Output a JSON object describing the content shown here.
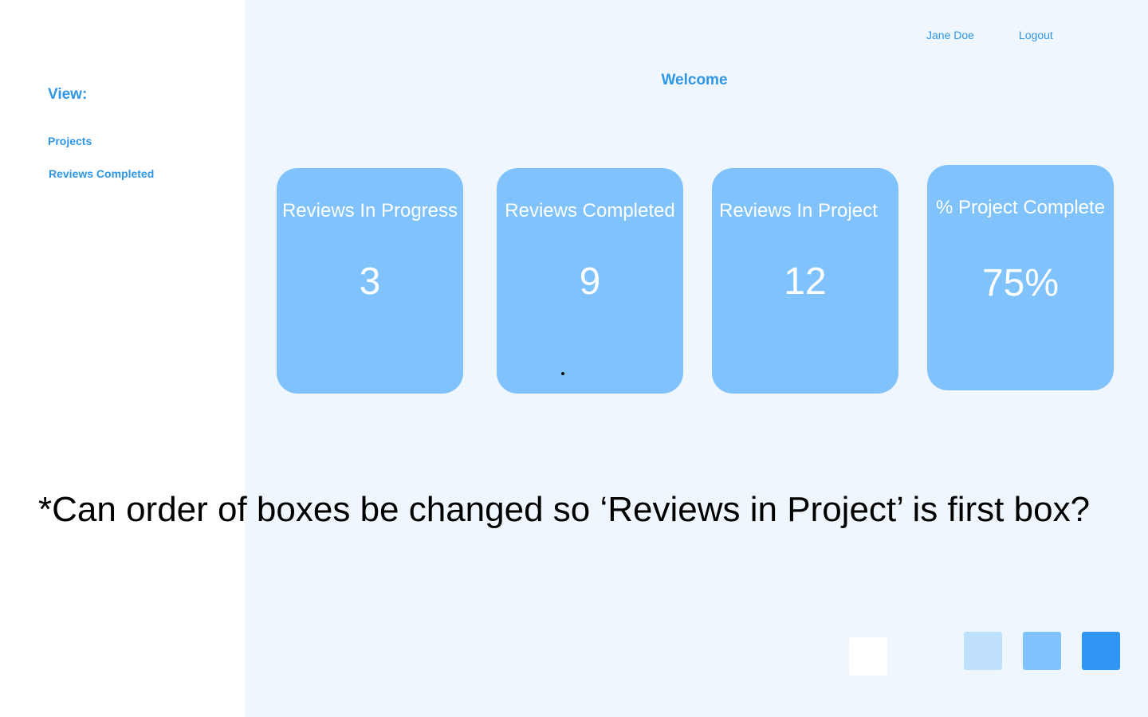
{
  "sidebar": {
    "heading": "View:",
    "items": [
      {
        "label": "Projects"
      },
      {
        "label": "Reviews Completed"
      }
    ]
  },
  "header": {
    "user_name": "Jane Doe",
    "logout_label": "Logout"
  },
  "main": {
    "title": "Welcome",
    "cards": [
      {
        "title": "Reviews In Progress",
        "value": "3"
      },
      {
        "title": "Reviews Completed",
        "value": "9"
      },
      {
        "title": "Reviews In Project",
        "value": "12"
      },
      {
        "title": "% Project Complete",
        "value": "75%"
      }
    ]
  },
  "annotation": {
    "text": "*Can order of boxes be changed so ‘Reviews in Project’ is first box?"
  },
  "palette": {
    "swatches": [
      "#ffffff",
      "#bfe0fd",
      "#7fc2fc",
      "#2f96f6"
    ]
  },
  "colors": {
    "accent": "#2f96e6",
    "card": "#7fc2fc",
    "main_background": "#eff6fd"
  }
}
